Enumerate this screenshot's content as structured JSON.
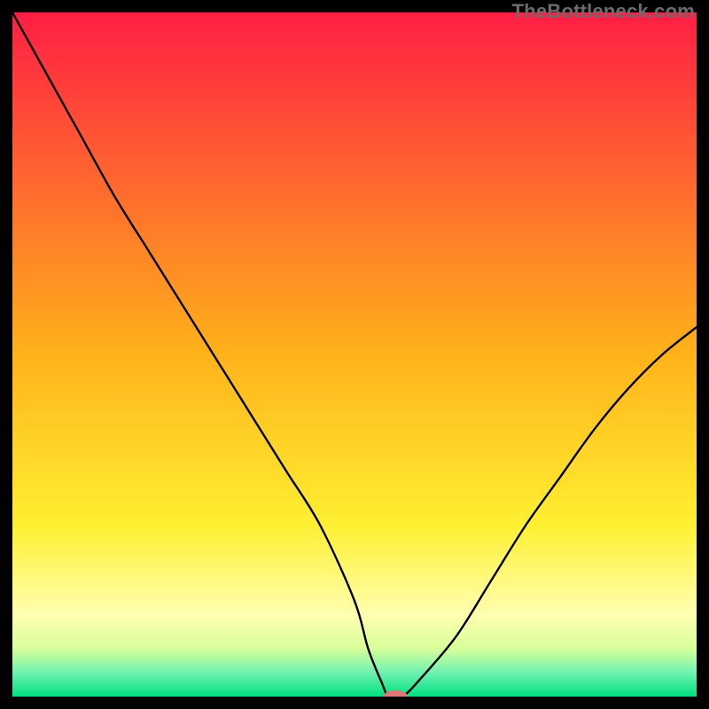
{
  "watermark": "TheBottleneck.com",
  "chart_data": {
    "type": "line",
    "title": "",
    "xlabel": "",
    "ylabel": "",
    "xlim": [
      0,
      100
    ],
    "ylim": [
      0,
      100
    ],
    "background_gradient": {
      "stops": [
        {
          "offset": 0.0,
          "color": "#ff1e44"
        },
        {
          "offset": 0.5,
          "color": "#ffb21a"
        },
        {
          "offset": 0.75,
          "color": "#fff032"
        },
        {
          "offset": 0.88,
          "color": "#ffffb0"
        },
        {
          "offset": 0.93,
          "color": "#d8ff9a"
        },
        {
          "offset": 0.965,
          "color": "#6ff2b0"
        },
        {
          "offset": 1.0,
          "color": "#00e07e"
        }
      ]
    },
    "series": [
      {
        "name": "bottleneck-curve",
        "stroke": "#000000",
        "x": [
          0,
          5,
          10,
          15,
          20,
          25,
          30,
          35,
          40,
          45,
          50,
          52,
          54,
          55,
          57,
          60,
          65,
          70,
          75,
          80,
          85,
          90,
          95,
          100
        ],
        "y": [
          100,
          91,
          82,
          73,
          65,
          57,
          49,
          41,
          33,
          25,
          14,
          7,
          2,
          0,
          0,
          3,
          9,
          17,
          25,
          32,
          39,
          45,
          50,
          54
        ]
      }
    ],
    "marker": {
      "name": "optimal-point",
      "x": 56,
      "y": 0,
      "color": "#e07878",
      "rx_pct": 1.8,
      "ry_pct": 0.9
    }
  }
}
